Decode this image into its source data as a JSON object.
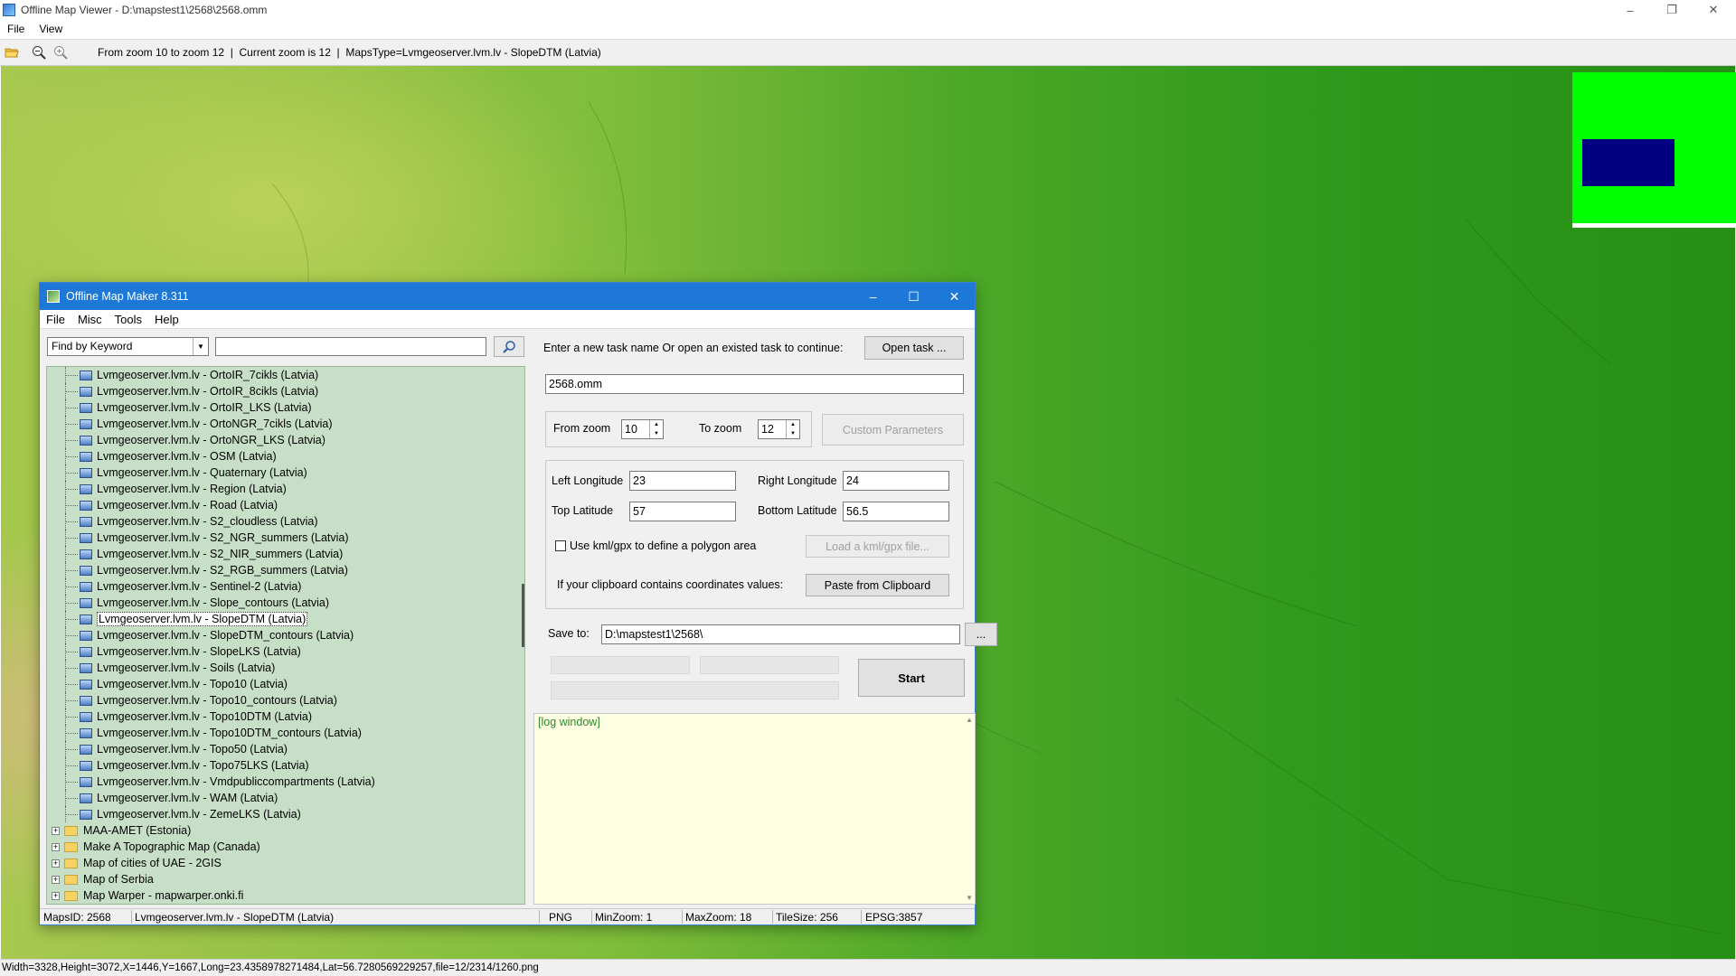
{
  "viewer": {
    "title": "Offline Map Viewer - D:\\mapstest1\\2568\\2568.omm",
    "menu": [
      "File",
      "View"
    ],
    "toolbar": {
      "zoom_range": "From zoom 10 to zoom 12",
      "separator1": "  |  ",
      "current_zoom": "Current zoom is 12",
      "separator2": "  |  ",
      "maps_type": "MapsType=Lvmgeoserver.lvm.lv - SlopeDTM (Latvia)"
    },
    "status": "Width=3328,Height=3072,X=1446,Y=1667,Long=23.4358978271484,Lat=56.7280569229257,file=12/2314/1260.png",
    "colors": {
      "overview_bg": "#00ff00",
      "overview_view": "#000080"
    }
  },
  "maker": {
    "title": "Offline Map Maker 8.311",
    "menu": [
      "File",
      "Misc",
      "Tools",
      "Help"
    ],
    "search": {
      "mode": "Find by Keyword",
      "query": ""
    },
    "tree": {
      "children": [
        "Lvmgeoserver.lvm.lv - OrtoIR_7cikls (Latvia)",
        "Lvmgeoserver.lvm.lv - OrtoIR_8cikls (Latvia)",
        "Lvmgeoserver.lvm.lv - OrtoIR_LKS (Latvia)",
        "Lvmgeoserver.lvm.lv - OrtoNGR_7cikls (Latvia)",
        "Lvmgeoserver.lvm.lv - OrtoNGR_LKS (Latvia)",
        "Lvmgeoserver.lvm.lv - OSM (Latvia)",
        "Lvmgeoserver.lvm.lv - Quaternary (Latvia)",
        "Lvmgeoserver.lvm.lv - Region (Latvia)",
        "Lvmgeoserver.lvm.lv - Road (Latvia)",
        "Lvmgeoserver.lvm.lv - S2_cloudless (Latvia)",
        "Lvmgeoserver.lvm.lv - S2_NGR_summers (Latvia)",
        "Lvmgeoserver.lvm.lv - S2_NIR_summers (Latvia)",
        "Lvmgeoserver.lvm.lv - S2_RGB_summers (Latvia)",
        "Lvmgeoserver.lvm.lv - Sentinel-2 (Latvia)",
        "Lvmgeoserver.lvm.lv - Slope_contours (Latvia)",
        "Lvmgeoserver.lvm.lv - SlopeDTM (Latvia)",
        "Lvmgeoserver.lvm.lv - SlopeDTM_contours (Latvia)",
        "Lvmgeoserver.lvm.lv - SlopeLKS (Latvia)",
        "Lvmgeoserver.lvm.lv - Soils (Latvia)",
        "Lvmgeoserver.lvm.lv - Topo10 (Latvia)",
        "Lvmgeoserver.lvm.lv - Topo10_contours (Latvia)",
        "Lvmgeoserver.lvm.lv - Topo10DTM (Latvia)",
        "Lvmgeoserver.lvm.lv - Topo10DTM_contours (Latvia)",
        "Lvmgeoserver.lvm.lv - Topo50 (Latvia)",
        "Lvmgeoserver.lvm.lv - Topo75LKS (Latvia)",
        "Lvmgeoserver.lvm.lv - Vmdpubliccompartments (Latvia)",
        "Lvmgeoserver.lvm.lv - WAM (Latvia)",
        "Lvmgeoserver.lvm.lv - ZemeLKS (Latvia)"
      ],
      "selected": "Lvmgeoserver.lvm.lv - SlopeDTM (Latvia)",
      "folders": [
        "MAA-AMET (Estonia)",
        "Make A Topographic Map (Canada)",
        "Map of cities of UAE - 2GIS",
        "Map of Serbia",
        "Map Warper - mapwarper.onki.fi"
      ]
    },
    "task": {
      "prompt": "Enter a new task name Or open an existed task to continue:",
      "open_button": "Open task ...",
      "name": "2568.omm"
    },
    "zoom": {
      "from_label": "From zoom",
      "from_value": "10",
      "to_label": "To zoom",
      "to_value": "12",
      "custom_button": "Custom Parameters"
    },
    "bounds": {
      "left_label": "Left Longitude",
      "left_value": "23",
      "right_label": "Right Longitude",
      "right_value": "24",
      "top_label": "Top Latitude",
      "top_value": "57",
      "bottom_label": "Bottom Latitude",
      "bottom_value": "56.5",
      "kml_label": "Use kml/gpx to define a polygon area",
      "kml_button": "Load a kml/gpx file...",
      "clipboard_label": "If your clipboard contains coordinates values:",
      "clipboard_button": "Paste from Clipboard"
    },
    "save": {
      "label": "Save to:",
      "path": "D:\\mapstest1\\2568\\",
      "browse": "...",
      "start": "Start"
    },
    "log": "[log window]",
    "status": {
      "maps_id": "MapsID: 2568",
      "map_name": "Lvmgeoserver.lvm.lv - SlopeDTM (Latvia)",
      "format": "PNG",
      "min_zoom": "MinZoom: 1",
      "max_zoom": "MaxZoom: 18",
      "tile_size": "TileSize: 256",
      "epsg": "EPSG:3857"
    }
  }
}
